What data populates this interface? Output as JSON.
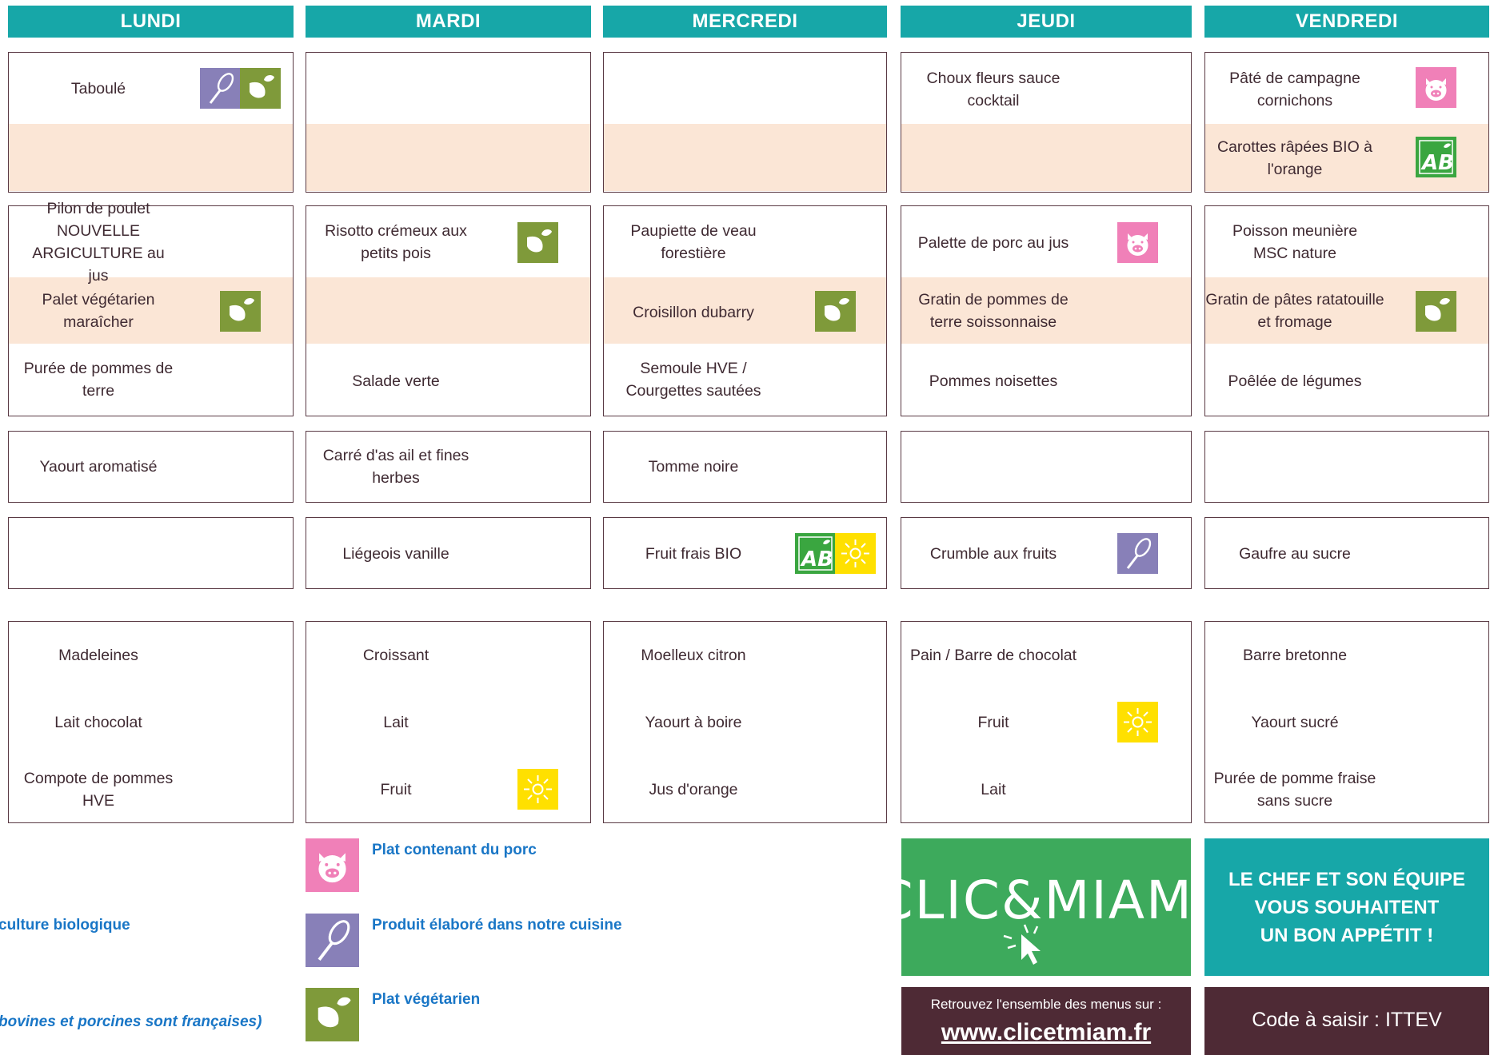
{
  "days": [
    "LUNDI",
    "MARDI",
    "MERCREDI",
    "JEUDI",
    "VENDREDI"
  ],
  "menu": {
    "lundi": {
      "entree1": "Taboulé",
      "entree2": "",
      "plat1": "Pilon de poulet NOUVELLE ARGICULTURE au jus",
      "plat2": "Palet végétarien maraîcher",
      "accomp": "Purée de pommes de terre",
      "laitage": "Yaourt aromatisé",
      "dessert": "",
      "gouter1": "Madeleines",
      "gouter2": "Lait chocolat",
      "gouter3": "Compote de pommes HVE"
    },
    "mardi": {
      "entree1": "",
      "entree2": "",
      "plat1": "Risotto crémeux aux petits pois",
      "plat2": "",
      "accomp": "Salade verte",
      "laitage": "Carré d'as ail et fines herbes",
      "dessert": "Liégeois vanille",
      "gouter1": "Croissant",
      "gouter2": "Lait",
      "gouter3": "Fruit"
    },
    "mercredi": {
      "entree1": "",
      "entree2": "",
      "plat1": "Paupiette de veau forestière",
      "plat2": "Croisillon dubarry",
      "accomp": "Semoule HVE / Courgettes sautées",
      "laitage": "Tomme noire",
      "dessert": "Fruit frais BIO",
      "gouter1": "Moelleux citron",
      "gouter2": "Yaourt à boire",
      "gouter3": "Jus d'orange"
    },
    "jeudi": {
      "entree1": "Choux fleurs sauce cocktail",
      "entree2": "",
      "plat1": "Palette de porc au jus",
      "plat2": "Gratin de pommes de terre soissonnaise",
      "accomp": "Pommes noisettes",
      "laitage": "",
      "dessert": "Crumble aux fruits",
      "gouter1": "Pain / Barre de chocolat",
      "gouter2": "Fruit",
      "gouter3": "Lait"
    },
    "vendredi": {
      "entree1": "Pâté de campagne cornichons",
      "entree2": "Carottes râpées BIO à l'orange",
      "plat1": "Poisson meunière MSC nature",
      "plat2": "Gratin de pâtes ratatouille et fromage",
      "accomp": "Poêlée de légumes",
      "laitage": "",
      "dessert": "Gaufre au sucre",
      "gouter1": "Barre bretonne",
      "gouter2": "Yaourt sucré",
      "gouter3": "Purée de pomme fraise sans sucre"
    }
  },
  "legend": {
    "porc": "Plat contenant du porc",
    "maison": "Produit élaboré dans notre cuisine",
    "vege": "Plat végétarien",
    "bio_partial": "culture biologique",
    "viande_partial": "bovines et porcines sont françaises)"
  },
  "logo_text": "CLIC&MIAM!",
  "chef_message": [
    "LE CHEF ET SON ÉQUIPE",
    "VOUS SOUHAITENT",
    "UN BON APPÉTIT !"
  ],
  "website_intro": "Retrouvez l'ensemble des menus sur :",
  "website_url": "www.clicetmiam.fr",
  "code_text": "Code à saisir : ITTEV",
  "colors": {
    "teal": "#17a7a8",
    "peach": "#fbe6d6",
    "plum": "#4e2a35",
    "green_logo": "#3daa5c",
    "vege_icon": "#7f9a3a",
    "porc_icon": "#f080b8",
    "maison_icon": "#8880b8",
    "bio_icon": "#3aa640",
    "saison_icon": "#ffe000",
    "legend_text": "#1976c6",
    "dish_text": "#3f2a32"
  },
  "icons": [
    "vegetarian-leaf-icon",
    "pig-icon",
    "whisk-icon",
    "ab-bio-icon",
    "sun-icon"
  ]
}
